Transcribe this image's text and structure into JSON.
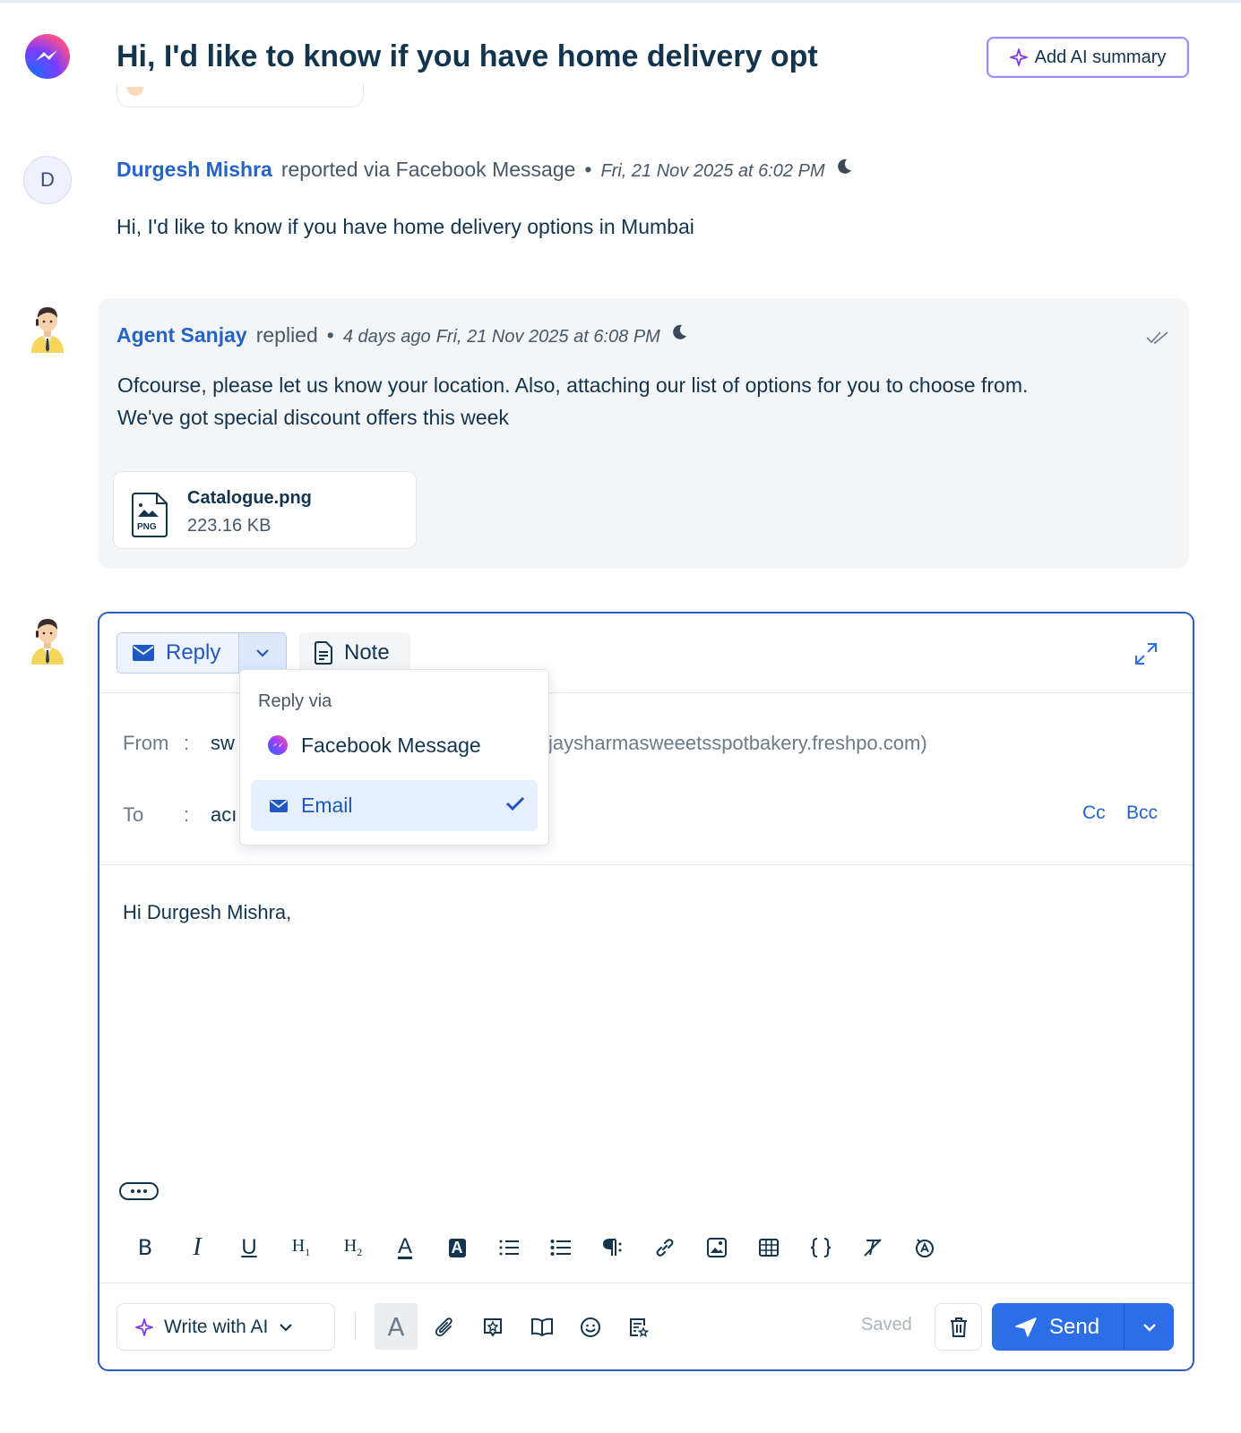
{
  "header": {
    "title": "Hi, I'd like to know if you have home delivery opt",
    "ai_summary_label": "Add AI summary",
    "channel_icon": "messenger-icon"
  },
  "conversation": {
    "customer_message": {
      "avatar_initial": "D",
      "author": "Durgesh Mishra",
      "action": "reported via Facebook Message",
      "timestamp": "Fri, 21 Nov 2025 at 6:02 PM",
      "body": "Hi, I'd like to know if you have home delivery options in Mumbai"
    },
    "agent_reply": {
      "author": "Agent Sanjay",
      "action": "replied",
      "relative_time": "4 days ago",
      "timestamp": "Fri, 21 Nov 2025 at 6:08 PM",
      "body_line1": "Ofcourse, please let us know your location. Also, attaching our list of options for you to choose from.",
      "body_line2": "We've got special discount offers this week",
      "attachment": {
        "name": "Catalogue.png",
        "size": "223.16 KB",
        "type_label": "PNG"
      }
    }
  },
  "editor": {
    "reply_label": "Reply",
    "note_label": "Note",
    "from_label": "From",
    "from_value_visible": "sw",
    "from_email_visible": "jaysharmasweeetsspotbakery.freshpo.com)",
    "to_label": "To",
    "to_value_visible": "acı",
    "separator": ":",
    "cc_label": "Cc",
    "bcc_label": "Bcc",
    "body": "Hi Durgesh Mishra,",
    "toolbar": [
      "B",
      "I",
      "U",
      "H1",
      "H2",
      "A",
      "A"
    ],
    "write_ai_label": "Write with AI",
    "saved_label": "Saved",
    "send_label": "Send"
  },
  "reply_dropdown": {
    "title": "Reply via",
    "options": [
      {
        "label": "Facebook Message",
        "icon": "messenger-icon",
        "selected": false
      },
      {
        "label": "Email",
        "icon": "mail-icon",
        "selected": true
      }
    ]
  },
  "colors": {
    "accent": "#2c6ee8",
    "link": "#2563c9",
    "text": "#12344d",
    "ai_border": "#a78bfa"
  }
}
